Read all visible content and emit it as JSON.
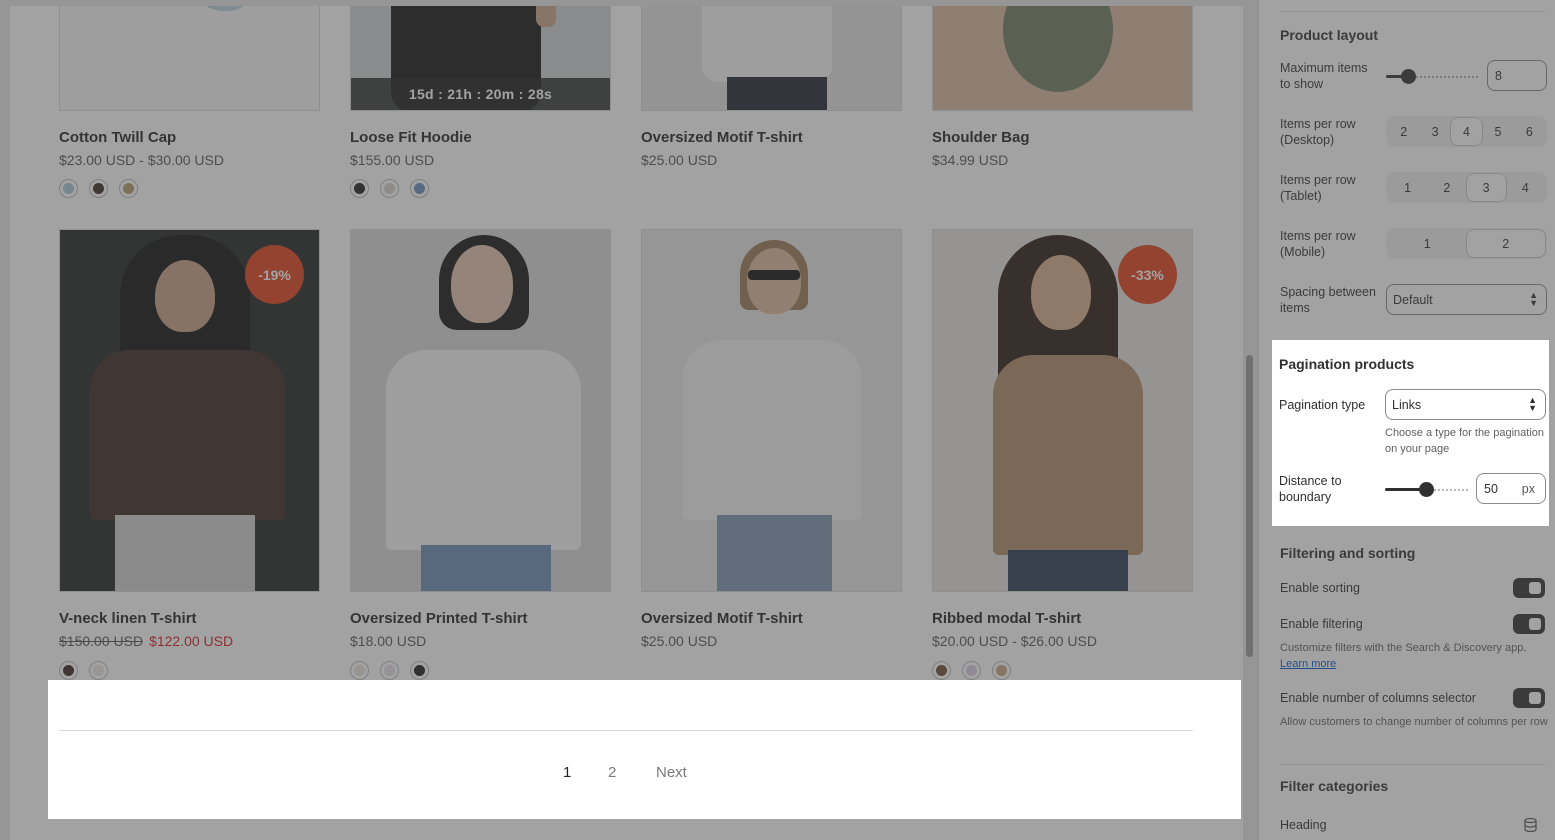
{
  "products_row1": [
    {
      "title": "Cotton Twill Cap",
      "price": "$23.00 USD - $30.00 USD",
      "swatches": [
        "#a8c4d4",
        "#3a2a22",
        "#b59a6a"
      ]
    },
    {
      "title": "Loose Fit Hoodie",
      "price": "$155.00 USD",
      "countdown": "15d : 21h : 20m : 28s",
      "swatches": [
        "#1e1e1e",
        "#d9d0c7",
        "#6c8dbf"
      ]
    },
    {
      "title": "Oversized Motif T-shirt",
      "price": "$25.00 USD",
      "swatches": []
    },
    {
      "title": "Shoulder Bag",
      "price": "$34.99 USD",
      "swatches": []
    }
  ],
  "products_row2": [
    {
      "title": "V-neck linen T-shirt",
      "price_old": "$150.00 USD",
      "price_sale": "$122.00 USD",
      "badge": "-19%",
      "swatches": [
        "#3a2420",
        "#e9e6e2"
      ]
    },
    {
      "title": "Oversized Printed T-shirt",
      "price": "$18.00 USD",
      "swatches": [
        "#e8e2dc",
        "#e9dfe5",
        "#1b1b1b"
      ]
    },
    {
      "title": "Oversized Motif T-shirt",
      "price": "$25.00 USD",
      "swatches": []
    },
    {
      "title": "Ribbed modal T-shirt",
      "price": "$20.00 USD - $26.00 USD",
      "badge": "-33%",
      "swatches": [
        "#6a4a36",
        "#d8cfe6",
        "#c9a27e"
      ]
    }
  ],
  "pagination": {
    "page1": "1",
    "page2": "2",
    "next": "Next"
  },
  "settings": {
    "product_layout": {
      "heading": "Product layout",
      "max_items_label": "Maximum items to show",
      "max_items_value": "8",
      "max_items_fraction": 0.2,
      "desktop_label": "Items per row (Desktop)",
      "desktop_options": [
        "2",
        "3",
        "4",
        "5",
        "6"
      ],
      "desktop_selected": "4",
      "tablet_label": "Items per row (Tablet)",
      "tablet_options": [
        "1",
        "2",
        "3",
        "4"
      ],
      "tablet_selected": "3",
      "mobile_label": "Items per row (Mobile)",
      "mobile_options": [
        "1",
        "2"
      ],
      "mobile_selected": "2",
      "spacing_label": "Spacing between items",
      "spacing_value": "Default"
    },
    "pagination": {
      "heading": "Pagination products",
      "type_label": "Pagination type",
      "type_value": "Links",
      "type_help": "Choose a type for the pagination on your page",
      "distance_label": "Distance to boundary",
      "distance_value": "50",
      "distance_unit": "px",
      "distance_fraction": 0.5
    },
    "filtering": {
      "heading": "Filtering and sorting",
      "sorting_label": "Enable sorting",
      "sorting_on": true,
      "filtering_label": "Enable filtering",
      "filtering_on": true,
      "filtering_help": "Customize filters with the Search & Discovery app.",
      "learn_more": "Learn more",
      "columns_label": "Enable number of columns selector",
      "columns_on": true,
      "columns_help": "Allow customers to change number of columns per row"
    },
    "filter_categories": {
      "heading": "Filter categories",
      "heading_label": "Heading"
    }
  },
  "colors": {
    "badge": "#e0411a",
    "sale_price": "#d61c1c",
    "link": "#005bd3",
    "toggle_on": "#303030"
  }
}
